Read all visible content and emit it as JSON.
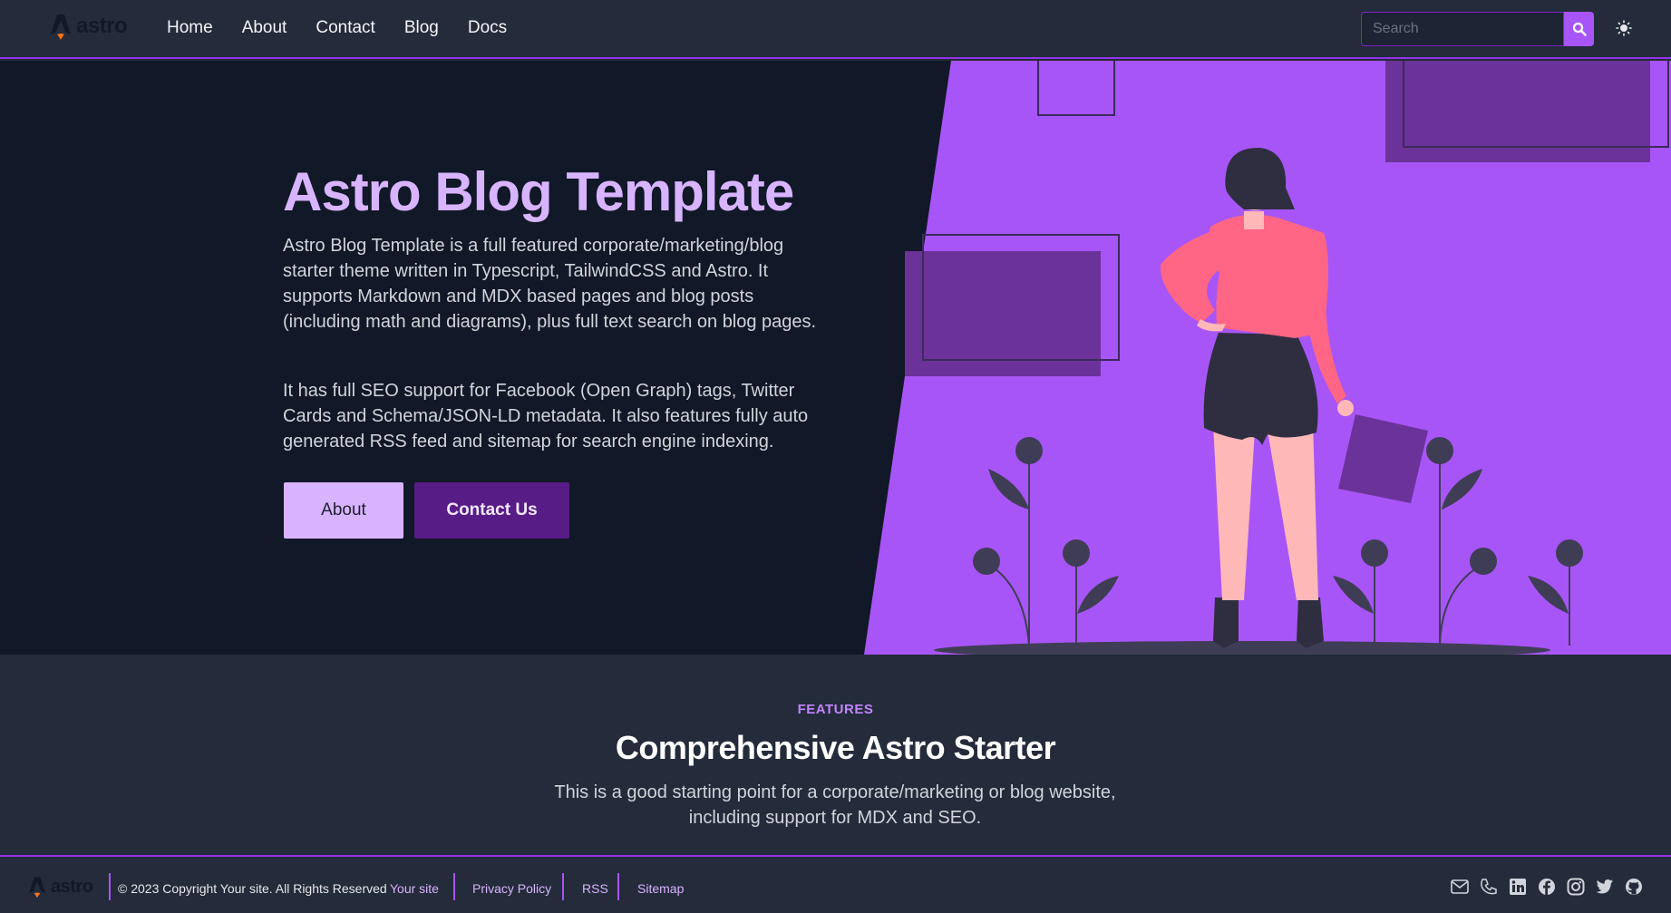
{
  "header": {
    "logo_text": "astro",
    "nav": [
      "Home",
      "About",
      "Contact",
      "Blog",
      "Docs"
    ],
    "search_placeholder": "Search"
  },
  "hero": {
    "title": "Astro Blog Template",
    "paragraph1": "Astro Blog Template is a full featured corporate/marketing/blog starter theme written in Typescript, TailwindCSS and Astro. It supports Markdown and MDX based pages and blog posts (including math and diagrams), plus full text search on blog pages.",
    "paragraph2": "It has full SEO support for Facebook (Open Graph) tags, Twitter Cards and Schema/JSON-LD metadata. It also features fully auto generated RSS feed and sitemap for search engine indexing.",
    "about_label": "About",
    "contact_label": "Contact Us"
  },
  "features": {
    "eyebrow": "FEATURES",
    "title": "Comprehensive Astro Starter",
    "description": "This is a good starting point for a corporate/marketing or blog website, including support for MDX and SEO."
  },
  "footer": {
    "logo_text": "astro",
    "copyright": "© 2023 Copyright Your site. All Rights Reserved",
    "site_link": "Your site",
    "links": [
      "Privacy Policy",
      "RSS",
      "Sitemap"
    ],
    "social_icons": [
      "mail-icon",
      "phone-icon",
      "linkedin-icon",
      "facebook-icon",
      "instagram-icon",
      "twitter-icon",
      "github-icon"
    ]
  },
  "colors": {
    "accent": "#a855f7",
    "hero_bg": "#111827",
    "page_bg": "#242b3a",
    "title": "#d8b4fe",
    "button_dark": "#581c87"
  }
}
